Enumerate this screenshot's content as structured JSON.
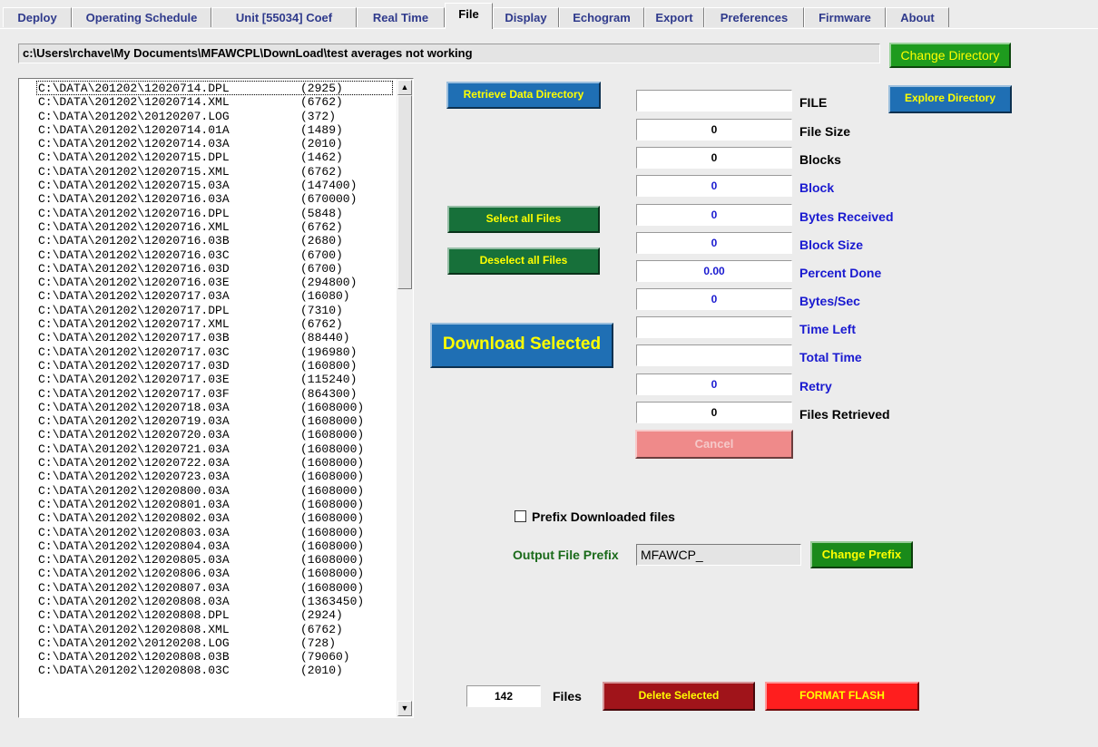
{
  "tabs": [
    {
      "label": "Deploy",
      "active": false
    },
    {
      "label": "Operating Schedule",
      "active": false
    },
    {
      "label": "Unit [55034] Coef",
      "active": false
    },
    {
      "label": "Real Time",
      "active": false
    },
    {
      "label": "File",
      "active": true
    },
    {
      "label": "Display",
      "active": false
    },
    {
      "label": "Echogram",
      "active": false
    },
    {
      "label": "Export",
      "active": false
    },
    {
      "label": "Preferences",
      "active": false
    },
    {
      "label": "Firmware",
      "active": false
    },
    {
      "label": "About",
      "active": false
    }
  ],
  "path": "c:\\Users\\rchave\\My Documents\\MFAWCPL\\DownLoad\\test averages not working",
  "buttons": {
    "change_directory": "Change Directory",
    "retrieve_data_directory": "Retrieve Data Directory",
    "explore_directory": "Explore Directory",
    "select_all": "Select all Files",
    "deselect_all": "Deselect all Files",
    "download_selected": "Download Selected",
    "cancel": "Cancel",
    "change_prefix": "Change Prefix",
    "delete_selected": "Delete Selected",
    "format_flash": "FORMAT FLASH"
  },
  "files": [
    {
      "name": "C:\\DATA\\201202\\12020714.DPL",
      "size": "(2925)"
    },
    {
      "name": "C:\\DATA\\201202\\12020714.XML",
      "size": "(6762)"
    },
    {
      "name": "C:\\DATA\\201202\\20120207.LOG",
      "size": "(372)"
    },
    {
      "name": "C:\\DATA\\201202\\12020714.01A",
      "size": "(1489)"
    },
    {
      "name": "C:\\DATA\\201202\\12020714.03A",
      "size": "(2010)"
    },
    {
      "name": "C:\\DATA\\201202\\12020715.DPL",
      "size": "(1462)"
    },
    {
      "name": "C:\\DATA\\201202\\12020715.XML",
      "size": "(6762)"
    },
    {
      "name": "C:\\DATA\\201202\\12020715.03A",
      "size": "(147400)"
    },
    {
      "name": "C:\\DATA\\201202\\12020716.03A",
      "size": "(670000)"
    },
    {
      "name": "C:\\DATA\\201202\\12020716.DPL",
      "size": "(5848)"
    },
    {
      "name": "C:\\DATA\\201202\\12020716.XML",
      "size": "(6762)"
    },
    {
      "name": "C:\\DATA\\201202\\12020716.03B",
      "size": "(2680)"
    },
    {
      "name": "C:\\DATA\\201202\\12020716.03C",
      "size": "(6700)"
    },
    {
      "name": "C:\\DATA\\201202\\12020716.03D",
      "size": "(6700)"
    },
    {
      "name": "C:\\DATA\\201202\\12020716.03E",
      "size": "(294800)"
    },
    {
      "name": "C:\\DATA\\201202\\12020717.03A",
      "size": "(16080)"
    },
    {
      "name": "C:\\DATA\\201202\\12020717.DPL",
      "size": "(7310)"
    },
    {
      "name": "C:\\DATA\\201202\\12020717.XML",
      "size": "(6762)"
    },
    {
      "name": "C:\\DATA\\201202\\12020717.03B",
      "size": "(88440)"
    },
    {
      "name": "C:\\DATA\\201202\\12020717.03C",
      "size": "(196980)"
    },
    {
      "name": "C:\\DATA\\201202\\12020717.03D",
      "size": "(160800)"
    },
    {
      "name": "C:\\DATA\\201202\\12020717.03E",
      "size": "(115240)"
    },
    {
      "name": "C:\\DATA\\201202\\12020717.03F",
      "size": "(864300)"
    },
    {
      "name": "C:\\DATA\\201202\\12020718.03A",
      "size": "(1608000)"
    },
    {
      "name": "C:\\DATA\\201202\\12020719.03A",
      "size": "(1608000)"
    },
    {
      "name": "C:\\DATA\\201202\\12020720.03A",
      "size": "(1608000)"
    },
    {
      "name": "C:\\DATA\\201202\\12020721.03A",
      "size": "(1608000)"
    },
    {
      "name": "C:\\DATA\\201202\\12020722.03A",
      "size": "(1608000)"
    },
    {
      "name": "C:\\DATA\\201202\\12020723.03A",
      "size": "(1608000)"
    },
    {
      "name": "C:\\DATA\\201202\\12020800.03A",
      "size": "(1608000)"
    },
    {
      "name": "C:\\DATA\\201202\\12020801.03A",
      "size": "(1608000)"
    },
    {
      "name": "C:\\DATA\\201202\\12020802.03A",
      "size": "(1608000)"
    },
    {
      "name": "C:\\DATA\\201202\\12020803.03A",
      "size": "(1608000)"
    },
    {
      "name": "C:\\DATA\\201202\\12020804.03A",
      "size": "(1608000)"
    },
    {
      "name": "C:\\DATA\\201202\\12020805.03A",
      "size": "(1608000)"
    },
    {
      "name": "C:\\DATA\\201202\\12020806.03A",
      "size": "(1608000)"
    },
    {
      "name": "C:\\DATA\\201202\\12020807.03A",
      "size": "(1608000)"
    },
    {
      "name": "C:\\DATA\\201202\\12020808.03A",
      "size": "(1363450)"
    },
    {
      "name": "C:\\DATA\\201202\\12020808.DPL",
      "size": "(2924)"
    },
    {
      "name": "C:\\DATA\\201202\\12020808.XML",
      "size": "(6762)"
    },
    {
      "name": "C:\\DATA\\201202\\20120208.LOG",
      "size": "(728)"
    },
    {
      "name": "C:\\DATA\\201202\\12020808.03B",
      "size": "(79060)"
    },
    {
      "name": "C:\\DATA\\201202\\12020808.03C",
      "size": "(2010)"
    }
  ],
  "status_fields": [
    {
      "label": "FILE",
      "value": "",
      "label_color": "black"
    },
    {
      "label": "File Size",
      "value": "0",
      "label_color": "black"
    },
    {
      "label": "Blocks",
      "value": "0",
      "label_color": "black"
    },
    {
      "label": "Block",
      "value": "0",
      "label_color": "blue"
    },
    {
      "label": "Bytes Received",
      "value": "0",
      "label_color": "blue"
    },
    {
      "label": "Block Size",
      "value": "0",
      "label_color": "blue"
    },
    {
      "label": "Percent Done",
      "value": "0.00",
      "label_color": "blue"
    },
    {
      "label": "Bytes/Sec",
      "value": "0",
      "label_color": "blue"
    },
    {
      "label": "Time Left",
      "value": "",
      "label_color": "blue"
    },
    {
      "label": "Total Time",
      "value": "",
      "label_color": "blue"
    },
    {
      "label": "Retry",
      "value": "0",
      "label_color": "blue"
    },
    {
      "label": "Files Retrieved",
      "value": "0",
      "label_color": "black"
    }
  ],
  "prefix": {
    "checkbox_label": "Prefix Downloaded files",
    "checked": false,
    "output_label": "Output File Prefix",
    "value": "MFAWCP_"
  },
  "file_count": {
    "value": "142",
    "label": "Files"
  },
  "colors": {
    "tab_text": "#2f3a8c",
    "status_blue": "#1a1ad0",
    "output_prefix_label": "#1a6a1a"
  }
}
